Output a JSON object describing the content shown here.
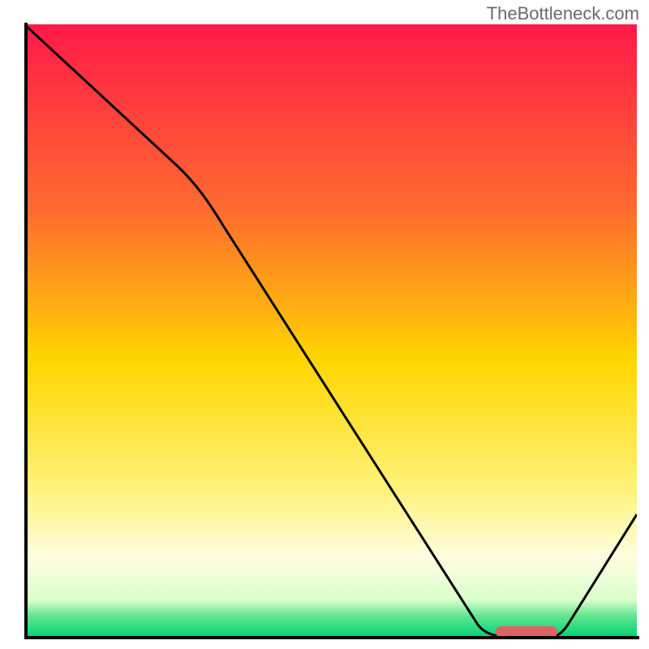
{
  "watermark": "TheBottleneck.com",
  "chart_data": {
    "type": "line",
    "title": "",
    "xlabel": "",
    "ylabel": "",
    "xlim": [
      0,
      100
    ],
    "ylim": [
      0,
      100
    ],
    "grid": false,
    "legend": false,
    "background_gradient": {
      "stops": [
        {
          "pos": 0.0,
          "color": "#ff1a48"
        },
        {
          "pos": 0.3,
          "color": "#ff6a2f"
        },
        {
          "pos": 0.55,
          "color": "#ffd600"
        },
        {
          "pos": 0.76,
          "color": "#fff27a"
        },
        {
          "pos": 0.87,
          "color": "#fffde0"
        },
        {
          "pos": 0.94,
          "color": "#d9ffcc"
        },
        {
          "pos": 0.965,
          "color": "#66e690"
        },
        {
          "pos": 1.0,
          "color": "#00d477"
        }
      ]
    },
    "series": [
      {
        "name": "curve",
        "x": [
          0,
          25,
          74,
          79,
          86,
          100
        ],
        "y": [
          100,
          77,
          2,
          0,
          0,
          20
        ]
      }
    ],
    "marker": {
      "name": "optimal-range",
      "x_start": 77,
      "x_end": 87,
      "y": 0
    }
  }
}
